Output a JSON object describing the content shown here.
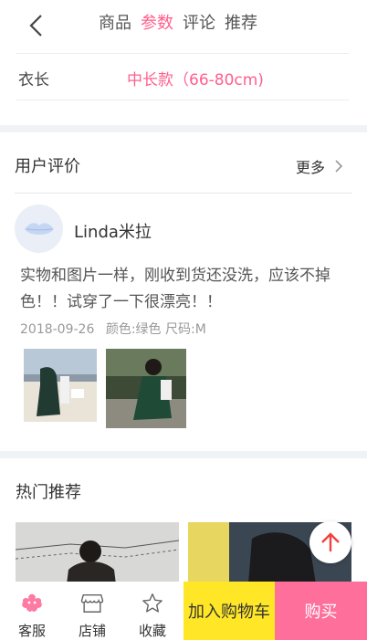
{
  "nav": {
    "tabs": [
      "商品",
      "参数",
      "评论",
      "推荐"
    ],
    "active_tab": "参数"
  },
  "params": {
    "label": "衣长",
    "value": "中长款（66-80cm)"
  },
  "reviews": {
    "title": "用户评价",
    "more_label": "更多",
    "user": "Linda米拉",
    "text": "实物和图片一样，刚收到货还没洗，应该不掉色！！试穿了一下很漂亮！！",
    "date": "2018-09-26",
    "spec": "颜色:绿色 尺码:M"
  },
  "recommend": {
    "title": "热门推荐"
  },
  "bottom_bar": {
    "service_label": "客服",
    "shop_label": "店铺",
    "favorite_label": "收藏",
    "cart_label": "加入购物车",
    "buy_label": "购买"
  },
  "colors": {
    "accent": "#ff5f8d",
    "cart_button": "#ffe727",
    "buy_button": "#ff6f9c"
  }
}
